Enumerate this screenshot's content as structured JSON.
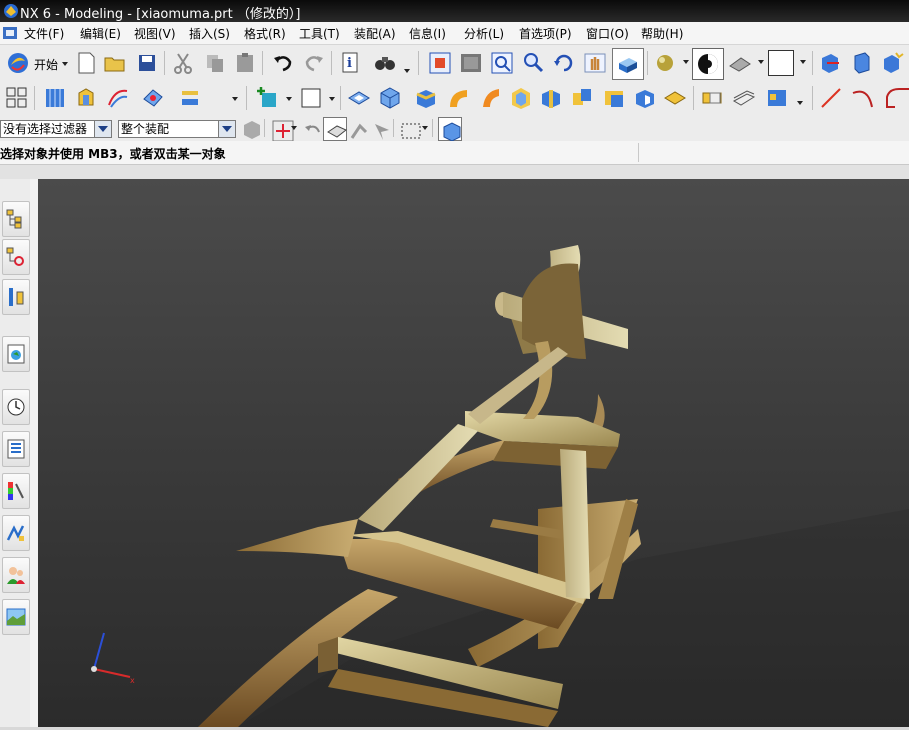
{
  "window": {
    "title": "NX 6 - Modeling - [xiaomuma.prt （修改的）]"
  },
  "menubar": {
    "items": [
      "文件(F)",
      "编辑(E)",
      "视图(V)",
      "插入(S)",
      "格式(R)",
      "工具(T)",
      "装配(A)",
      "信息(I)",
      "分析(L)",
      "首选项(P)",
      "窗口(O)",
      "帮助(H)"
    ]
  },
  "toolbar": {
    "start_label": "开始",
    "icons_row1": [
      "new-file-icon",
      "open-file-icon",
      "save-icon",
      "cut-icon",
      "copy-icon",
      "paste-icon",
      "undo-icon",
      "redo-icon",
      "information-icon",
      "binoculars-icon",
      "fit-view-icon",
      "zoom-window-icon",
      "zoom-box-icon",
      "zoom-icon",
      "rotate-icon",
      "pan-icon",
      "shaded-view-icon",
      "sphere-render-icon",
      "display-mode-icon",
      "perspective-icon",
      "color-box-icon",
      "move-component-icon",
      "assembly-constraints-icon",
      "explode-icon"
    ],
    "icons_row2": [
      "application-icon",
      "part-navigator-icon",
      "sketch-icon",
      "extrude-icon",
      "revolve-icon",
      "datum-plane-icon",
      "point-icon",
      "face-icon",
      "block-icon",
      "cylinder-icon",
      "feature-icon",
      "edge-blend-icon",
      "chamfer-icon",
      "shell-icon",
      "trim-icon",
      "unite-icon",
      "subtract-icon",
      "intersect-icon",
      "mirror-icon",
      "pattern-icon",
      "offset-icon",
      "thicken-icon",
      "line-icon",
      "arc-icon",
      "curve-icon"
    ]
  },
  "selection_bar": {
    "filter_value": "没有选择过滤器",
    "scope_value": "整个装配"
  },
  "status": {
    "prompt": "选择对象并使用 MB3，或者双击某一对象"
  },
  "resource_bar": {
    "items": [
      "assembly-navigator-icon",
      "constraint-navigator-icon",
      "part-navigator-icon",
      "web-browser-icon",
      "history-icon",
      "system-materials-icon",
      "visualization-icon",
      "process-studio-icon",
      "roles-icon",
      "system-scenes-icon"
    ]
  },
  "viewport": {
    "model_name": "xiaomuma",
    "triad_x_label": "x"
  },
  "colors": {
    "viewport_top": "#4b4b4b",
    "viewport_bottom": "#2b2b2b",
    "wood_light": "#c9b98a",
    "wood_dark": "#6b4a22",
    "titlebar": "#111111"
  }
}
